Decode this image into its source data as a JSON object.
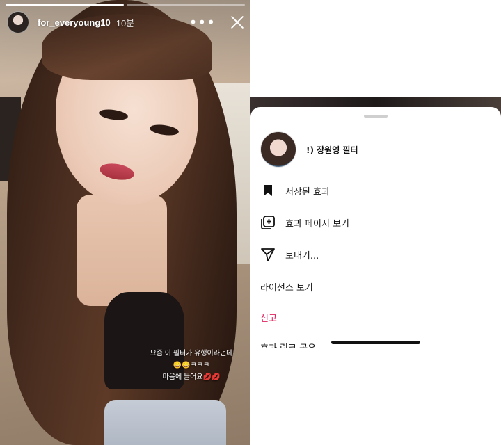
{
  "story": {
    "username": "for_everyoung10",
    "time": "10분",
    "more_label": "•••",
    "caption_lines": [
      "요즘 이 필터가 유행이라던데",
      "😄😄ㅋㅋㅋ",
      "마음에 들어요💋💋"
    ],
    "progress_segments": 2,
    "progress_done_fraction": 0.5
  },
  "sheet": {
    "effect_name": "!) 장원영 필터",
    "menu": [
      {
        "label": "저장된 효과",
        "icon": "bookmark-icon"
      },
      {
        "label": "효과 페이지 보기",
        "icon": "add-square-icon"
      },
      {
        "label": "보내기...",
        "icon": "send-icon"
      },
      {
        "label": "라이선스 보기",
        "icon": ""
      },
      {
        "label": "신고",
        "icon": "",
        "danger": true
      }
    ],
    "cutoff_label": "효과 링크 공유"
  },
  "colors": {
    "danger": "#e0245e",
    "text": "#111111",
    "divider": "#e6e6e6"
  }
}
